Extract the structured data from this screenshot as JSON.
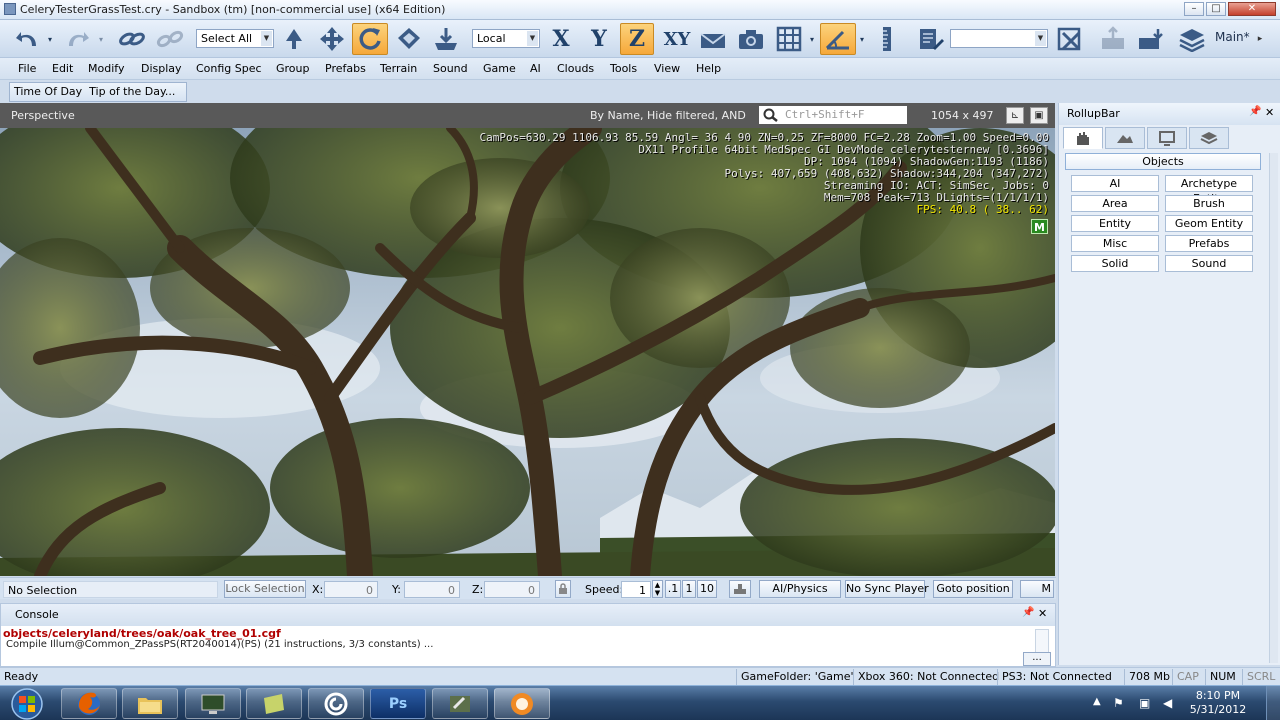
{
  "window": {
    "title": "CeleryTesterGrassTest.cry - Sandbox (tm) [non-commercial use] (x64 Edition)"
  },
  "toolbar": {
    "select_combo": "Select All",
    "coord_combo": "Local",
    "axis_x": "X",
    "axis_y": "Y",
    "axis_z": "Z",
    "axis_xy": "XY",
    "search_combo": "",
    "layout_label": "Main*"
  },
  "menu": [
    "File",
    "Edit",
    "Modify",
    "Display",
    "Config Spec",
    "Group",
    "Prefabs",
    "Terrain",
    "Sound",
    "Game",
    "AI",
    "Clouds",
    "Tools",
    "View",
    "Help"
  ],
  "toolbar2": {
    "time_of_day": "Time Of Day",
    "tip": "Tip of the Day..."
  },
  "viewport": {
    "name": "Perspective",
    "filter_text": "By Name, Hide filtered, AND",
    "search_placeholder": "Ctrl+Shift+F",
    "resolution": "1054 x 497",
    "debug_lines": [
      "CamPos=630.29 1106.93 85.59 Angl= 36  4 90 ZN=0.25 ZF=8000 FC=2.28 Zoom=1.00 Speed=0.00",
      "DX11 Profile 64bit MedSpec GI DevMode celerytesternew [0.3696]",
      "DP: 1094 (1094) ShadowGen:1193 (1186)",
      "Polys: 407,659 (408,632) Shadow:344,204 (347,272)",
      "Streaming IO: ACT:  SimSec, Jobs: 0",
      "Mem=708 Peak=713 DLights=(1/1/1/1)"
    ],
    "fps": "FPS: 40.8 ( 38.. 62)",
    "badge": "M"
  },
  "statusrow": {
    "selection": "No Selection",
    "lock_selection": "Lock Selection",
    "x_label": "X:",
    "x_value": "0",
    "y_label": "Y:",
    "y_value": "0",
    "z_label": "Z:",
    "z_value": "0",
    "speed_label": "Speed:",
    "speed_value": "1",
    "speed_opts": [
      ".1",
      "1",
      "10"
    ],
    "ai_physics": "AI/Physics",
    "no_sync": "No Sync Player",
    "goto": "Goto position",
    "more": "M"
  },
  "console": {
    "title": "Console",
    "line1": "objects/celeryland/trees/oak/oak_tree_01.cgf",
    "line2": "Compile Illum@Common_ZPassPS(RT2040014)(PS) (21 instructions, 3/3 constants) ...",
    "more_button": "..."
  },
  "rollup": {
    "title": "RollupBar",
    "objects_label": "Objects",
    "buttons": [
      "AI",
      "Archetype Entity",
      "Area",
      "Brush",
      "Entity",
      "Geom Entity",
      "Misc",
      "Prefabs",
      "Solid",
      "Sound"
    ]
  },
  "statusbar": {
    "ready": "Ready",
    "game_folder": "GameFolder: 'Game'",
    "xbox": "Xbox 360: Not Connected",
    "ps3": "PS3: Not Connected",
    "memory": "708 Mb",
    "cap": "CAP",
    "num": "NUM",
    "scrl": "SCRL"
  },
  "taskbar": {
    "time": "8:10 PM",
    "date": "5/31/2012",
    "ps_label": "Ps"
  },
  "colors": {
    "accent": "#f6a83a",
    "viewport_header": "#595959",
    "fps": "#f2e600",
    "console_error": "#b00000"
  }
}
